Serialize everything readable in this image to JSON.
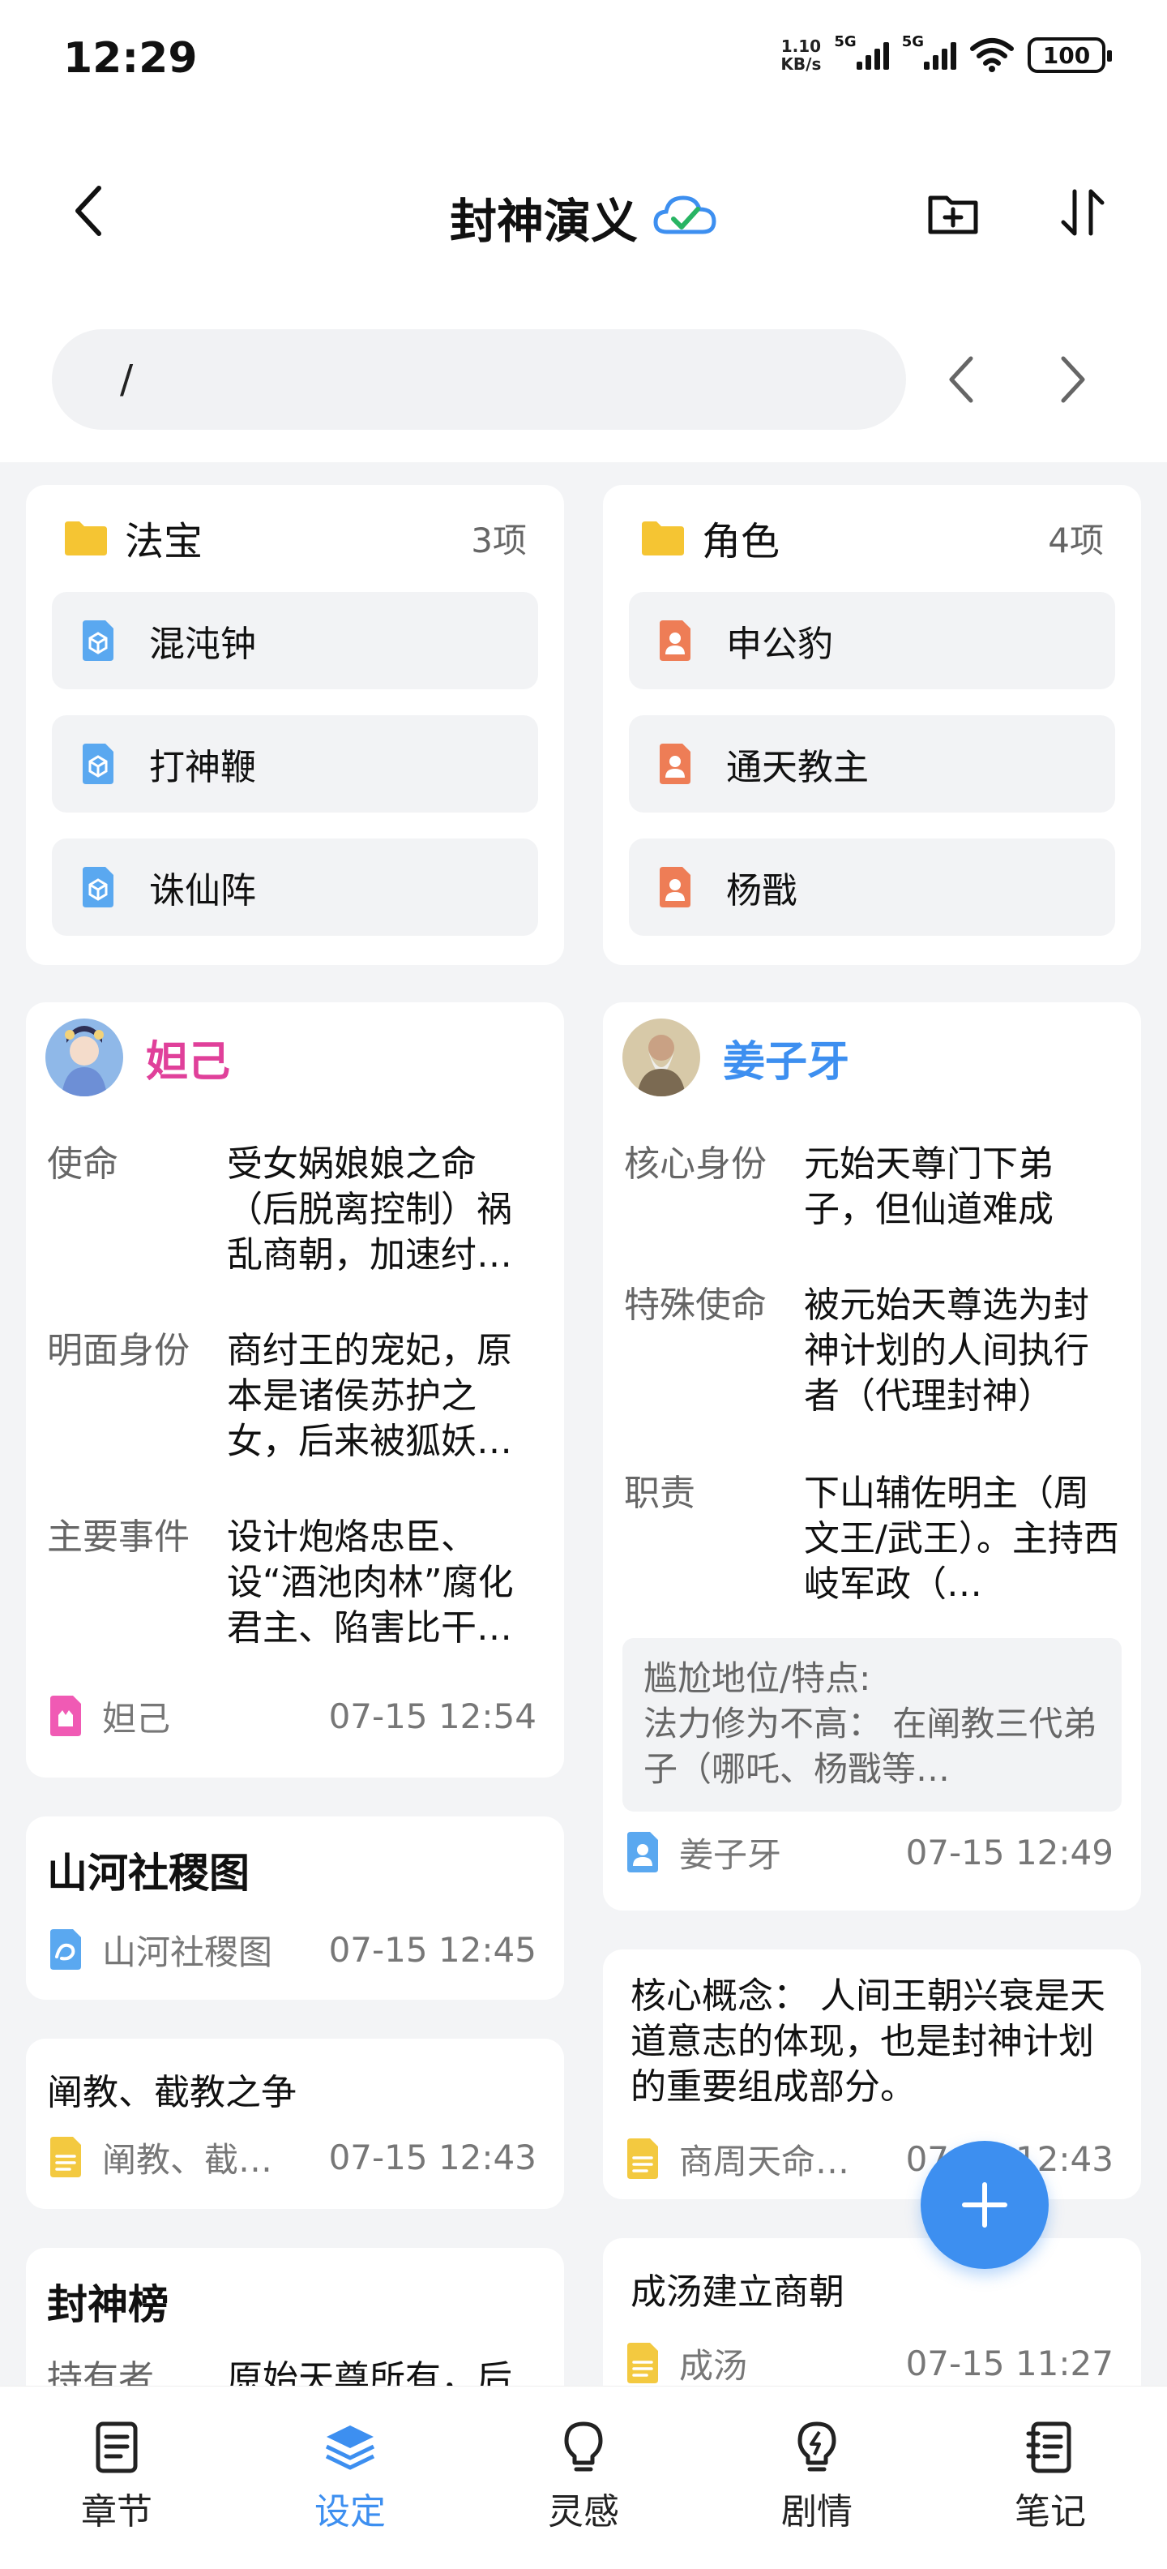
{
  "status": {
    "time": "12:29",
    "speed_top": "1.10",
    "speed_bottom": "KB/s",
    "sim1": "5G",
    "sim2": "5G",
    "battery": "100"
  },
  "header": {
    "title": "封神演义"
  },
  "path": {
    "value": "/"
  },
  "folders": [
    {
      "title": "法宝",
      "count": "3项",
      "items": [
        "混沌钟",
        "打神鞭",
        "诛仙阵"
      ]
    },
    {
      "title": "角色",
      "count": "4项",
      "items": [
        "申公豹",
        "通天教主",
        "杨戬"
      ]
    }
  ],
  "cards_left": {
    "daji": {
      "name": "妲己",
      "attrs": [
        {
          "k": "使命",
          "v": "受女娲娘娘之命（后脱离控制）祸乱商朝，加速纣…"
        },
        {
          "k": "明面身份",
          "v": "商纣王的宠妃，原本是诸侯苏护之女，后来被狐妖…"
        },
        {
          "k": "主要事件",
          "v": "设计炮烙忠臣、设“酒池肉林”腐化君主、陷害比干…"
        }
      ],
      "foot_label": "妲己",
      "foot_time": "07-15 12:54"
    },
    "shanhe": {
      "title": "山河社稷图",
      "foot_label": "山河社稷图",
      "foot_time": "07-15 12:45"
    },
    "chanjie": {
      "title": "阐教、截教之争",
      "foot_label": "阐教、截…",
      "foot_time": "07-15 12:43"
    },
    "fengshen": {
      "title": "封神榜",
      "attr_k": "持有者",
      "attr_v": "原始天尊所有，后"
    }
  },
  "cards_right": {
    "jiang": {
      "name": "姜子牙",
      "attrs": [
        {
          "k": "核心身份",
          "v": "元始天尊门下弟子，但仙道难成"
        },
        {
          "k": "特殊使命",
          "v": "被元始天尊选为封神计划的人间执行者（代理封神）"
        },
        {
          "k": "职责",
          "v": "下山辅佐明主（周文王/武王）。主持西岐军政（…"
        }
      ],
      "note_title": "尴尬地位/特点:",
      "note_body": "法力修为不高： 在阐教三代弟子（哪吒、杨戬等…",
      "foot_label": "姜子牙",
      "foot_time": "07-15 12:49"
    },
    "concept": {
      "text": "核心概念： 人间王朝兴衰是天道意志的体现，也是封神计划的重要组成部分。",
      "foot_label": "商周天命…",
      "foot_time": "07-15 12:43"
    },
    "chengtang": {
      "title": "成汤建立商朝",
      "foot_label": "成汤",
      "foot_time": "07-15 11:27"
    }
  },
  "tabs": [
    {
      "label": "章节",
      "icon": "document-icon"
    },
    {
      "label": "设定",
      "icon": "layers-icon"
    },
    {
      "label": "灵感",
      "icon": "lightbulb-icon"
    },
    {
      "label": "剧情",
      "icon": "bolt-bulb-icon"
    },
    {
      "label": "笔记",
      "icon": "notebook-icon"
    }
  ],
  "colors": {
    "accent": "#3d8ff0",
    "daji_name": "#e0409a",
    "jiang_name": "#3d8ff0",
    "folder": "#f5c533",
    "item_blue": "#5aa8f0",
    "item_orange": "#ee7d56",
    "doc_yellow": "#f3c940",
    "daji_doc": "#f05ab4"
  }
}
